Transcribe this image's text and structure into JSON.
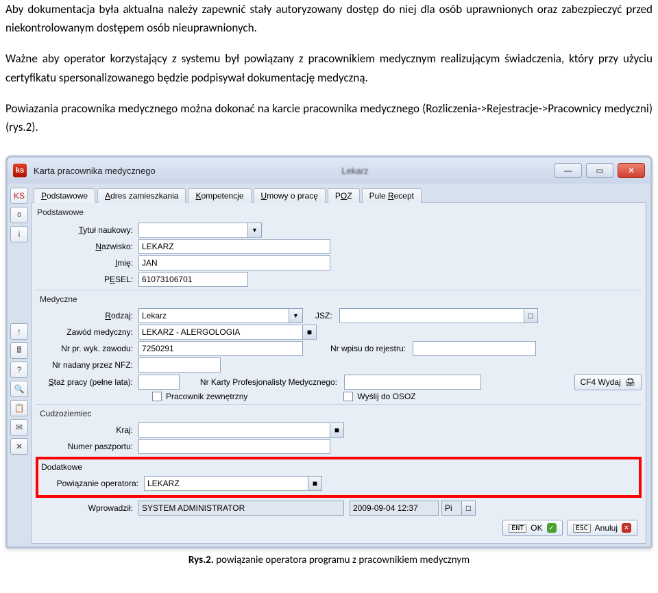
{
  "doc": {
    "p1": "Aby dokumentacja była aktualna należy zapewnić stały autoryzowany dostęp do niej dla osób uprawnionych oraz zabezpieczyć przed niekontrolowanym dostępem osób nieuprawnionych.",
    "p2": "Ważne aby operator korzystający z systemu był powiązany z pracownikiem medycznym realizującym świadczenia, który przy użyciu certyfikatu spersonalizowanego będzie podpisywał dokumentację medyczną.",
    "p3": "Powiazania pracownika medycznego można dokonać na karcie pracownika medycznego (Rozliczenia->Rejestracje->Pracownicy medyczni) (rys.2)."
  },
  "window": {
    "title": "Karta pracownika medycznego",
    "center": "Lekarz"
  },
  "sidebar": {
    "b0": "KS",
    "b1": "0",
    "b2": "i",
    "b3": "↑",
    "b4": "🖩",
    "b5": "?",
    "b6": "🔍",
    "b7": "📋",
    "b8": "✉",
    "b9": "✕"
  },
  "tabs": [
    {
      "label": "Podstawowe",
      "u": "P"
    },
    {
      "label": "Adres zamieszkania",
      "u": "A"
    },
    {
      "label": "Kompetencje",
      "u": "K"
    },
    {
      "label": "Umowy o pracę",
      "u": "U"
    },
    {
      "label": "POZ",
      "u": "O"
    },
    {
      "label": "Pule Recept",
      "u": "R"
    }
  ],
  "groups": {
    "podstawowe": "Podstawowe",
    "medyczne": "Medyczne",
    "cudzoziemiec": "Cudzoziemiec",
    "dodatkowe": "Dodatkowe"
  },
  "fields": {
    "tytul_lbl": "Tytuł naukowy:",
    "tytul_val": "",
    "nazwisko_lbl": "Nazwisko:",
    "nazwisko_val": "LEKARZ",
    "imie_lbl": "Imię:",
    "imie_val": "JAN",
    "pesel_lbl": "PESEL:",
    "pesel_val": "61073106701",
    "rodzaj_lbl": "Rodzaj:",
    "rodzaj_val": "Lekarz",
    "jsz_lbl": "JSZ:",
    "jsz_val": "",
    "zawod_lbl": "Zawód medyczny:",
    "zawod_val": "LEKARZ - ALERGOLOGIA",
    "nrpr_lbl": "Nr pr. wyk. zawodu:",
    "nrpr_val": "7250291",
    "nrwpisu_lbl": "Nr wpisu do rejestru:",
    "nrwpisu_val": "",
    "nfz_lbl": "Nr nadany przez NFZ:",
    "nfz_val": "",
    "staz_lbl": "Staż pracy (pełne lata):",
    "staz_val": "",
    "karta_lbl": "Nr Karty Profesjonalisty Medycznego:",
    "karta_val": "",
    "cf4_btn": "CF4 Wydaj",
    "chk1_lbl": "Pracownik zewnętrzny",
    "chk2_lbl": "Wyślij do OSOZ",
    "kraj_lbl": "Kraj:",
    "kraj_val": "",
    "paszport_lbl": "Numer paszportu:",
    "paszport_val": "",
    "powiazanie_lbl": "Powiązanie operatora:",
    "powiazanie_val": "LEKARZ",
    "wprowadzil_lbl": "Wprowadził:",
    "wprowadzil_val": "SYSTEM ADMINISTRATOR",
    "data_val": "2009-09-04 12:37",
    "pi_val": "Pi"
  },
  "footer": {
    "ok_kbd": "ENT",
    "ok_lbl": "OK",
    "cancel_kbd": "ESC",
    "cancel_lbl": "Anuluj"
  },
  "caption": {
    "bold": "Rys.2.",
    "text": " powiązanie operatora programu z pracownikiem medycznym"
  }
}
